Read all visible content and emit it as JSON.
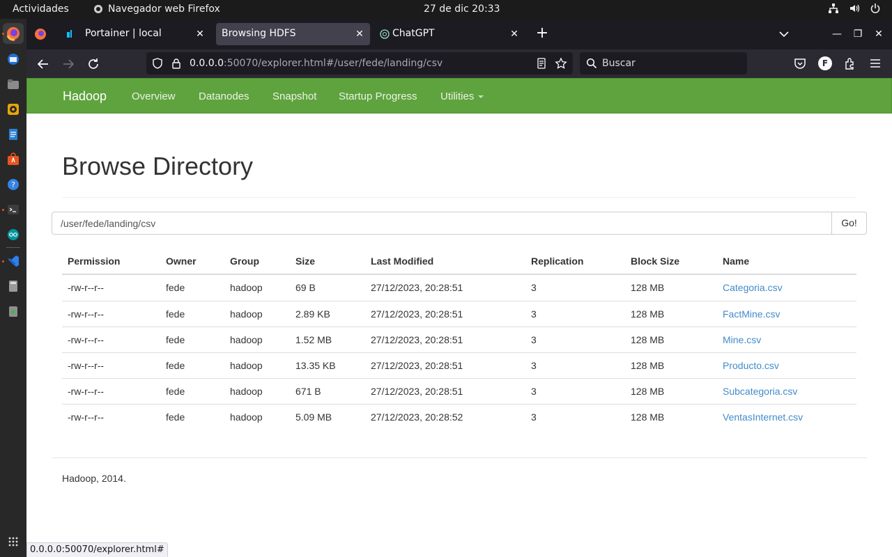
{
  "system": {
    "activities": "Actividades",
    "app_name": "Navegador web Firefox",
    "clock": "27 de dic  20:33"
  },
  "browser": {
    "tabs": [
      {
        "label": "Portainer | local",
        "active": false,
        "icon": "portainer-icon"
      },
      {
        "label": "Browsing HDFS",
        "active": true,
        "icon": "hadoop-icon"
      },
      {
        "label": "ChatGPT",
        "active": false,
        "icon": "chatgpt-icon"
      }
    ],
    "url_host": "0.0.0.0",
    "url_rest": ":50070/explorer.html#/user/fede/landing/csv",
    "search_placeholder": "Buscar",
    "account_initial": "F",
    "status_url": "0.0.0.0:50070/explorer.html#"
  },
  "hadoop": {
    "brand": "Hadoop",
    "nav": [
      "Overview",
      "Datanodes",
      "Snapshot",
      "Startup Progress",
      "Utilities"
    ],
    "page_title": "Browse Directory",
    "path_value": "/user/fede/landing/csv",
    "go_label": "Go!",
    "columns": [
      "Permission",
      "Owner",
      "Group",
      "Size",
      "Last Modified",
      "Replication",
      "Block Size",
      "Name"
    ],
    "rows": [
      [
        "-rw-r--r--",
        "fede",
        "hadoop",
        "69 B",
        "27/12/2023, 20:28:51",
        "3",
        "128 MB",
        "Categoria.csv"
      ],
      [
        "-rw-r--r--",
        "fede",
        "hadoop",
        "2.89 KB",
        "27/12/2023, 20:28:51",
        "3",
        "128 MB",
        "FactMine.csv"
      ],
      [
        "-rw-r--r--",
        "fede",
        "hadoop",
        "1.52 MB",
        "27/12/2023, 20:28:51",
        "3",
        "128 MB",
        "Mine.csv"
      ],
      [
        "-rw-r--r--",
        "fede",
        "hadoop",
        "13.35 KB",
        "27/12/2023, 20:28:51",
        "3",
        "128 MB",
        "Producto.csv"
      ],
      [
        "-rw-r--r--",
        "fede",
        "hadoop",
        "671 B",
        "27/12/2023, 20:28:51",
        "3",
        "128 MB",
        "Subcategoria.csv"
      ],
      [
        "-rw-r--r--",
        "fede",
        "hadoop",
        "5.09 MB",
        "27/12/2023, 20:28:52",
        "3",
        "128 MB",
        "VentasInternet.csv"
      ]
    ],
    "footer": "Hadoop, 2014."
  },
  "colors": {
    "navbar_green": "#5fa33e",
    "link_blue": "#428bca",
    "ubuntu_orange": "#e95420"
  }
}
